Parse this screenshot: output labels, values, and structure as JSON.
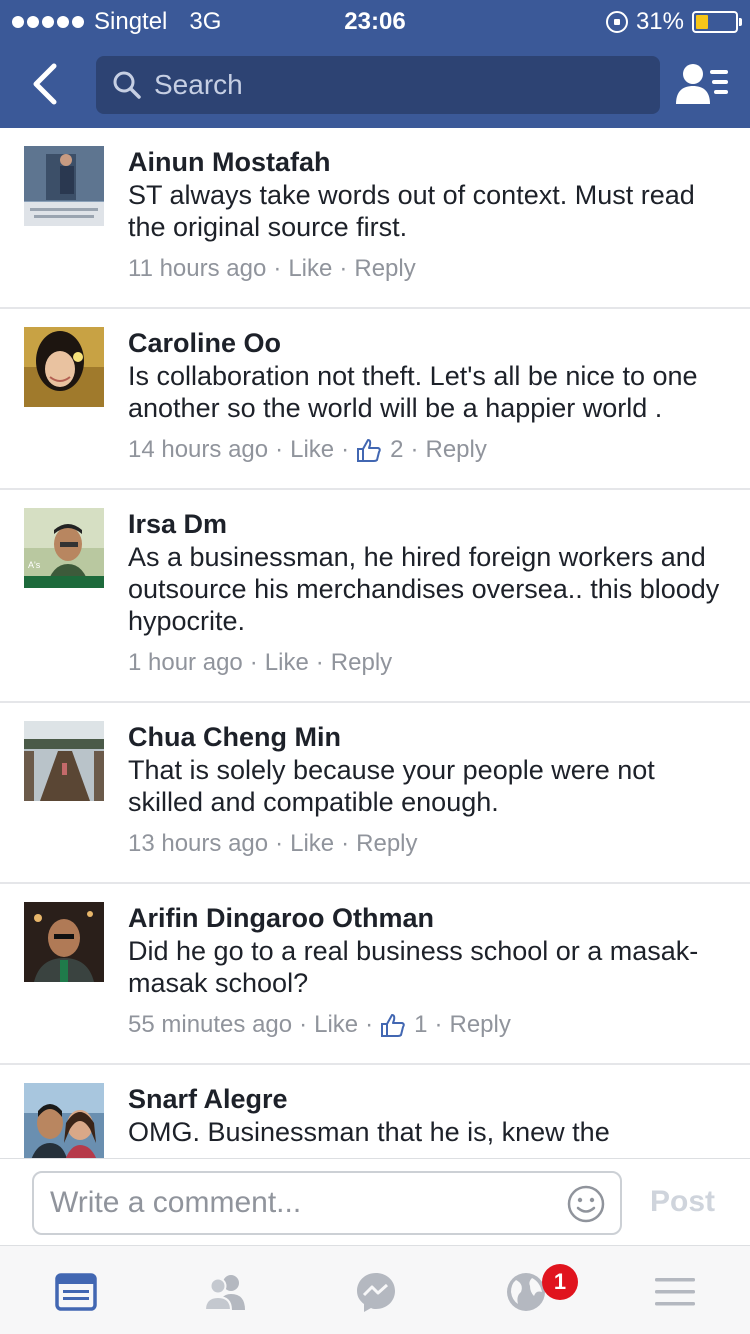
{
  "status_bar": {
    "carrier": "Singtel",
    "network": "3G",
    "time": "23:06",
    "battery": "31%",
    "battery_level": 0.31
  },
  "nav": {
    "search_placeholder": "Search"
  },
  "comments": [
    {
      "name": "Ainun Mostafah",
      "text": "ST always take words out of context. Must read the original source first.",
      "time": "11 hours ago",
      "like": "Like",
      "reply": "Reply",
      "likes": ""
    },
    {
      "name": "Caroline Oo",
      "text": "Is collaboration not theft. Let's all be nice to one another so the world will be a happier world .",
      "time": "14 hours ago",
      "like": "Like",
      "reply": "Reply",
      "likes": "2"
    },
    {
      "name": "Irsa Dm",
      "text": "As a businessman, he hired foreign workers and outsource his merchandises oversea.. this bloody hypocrite.",
      "time": "1 hour ago",
      "like": "Like",
      "reply": "Reply",
      "likes": ""
    },
    {
      "name": "Chua Cheng Min",
      "text": "That is solely because your people were not skilled and compatible enough.",
      "time": "13 hours ago",
      "like": "Like",
      "reply": "Reply",
      "likes": ""
    },
    {
      "name": "Arifin Dingaroo Othman",
      "text": "Did he go to a real business school or a masak-masak school?",
      "time": "55 minutes ago",
      "like": "Like",
      "reply": "Reply",
      "likes": "1"
    },
    {
      "name": "Snarf Alegre",
      "text": "OMG. Businessman that he is, knew the",
      "time": "",
      "like": "",
      "reply": "",
      "likes": ""
    }
  ],
  "composer": {
    "placeholder": "Write a comment...",
    "post_label": "Post"
  },
  "tabbar": {
    "notifications_badge": "1"
  },
  "colors": {
    "brand": "#3b5998",
    "link_gray": "#90949c",
    "badge": "#e0141e"
  }
}
